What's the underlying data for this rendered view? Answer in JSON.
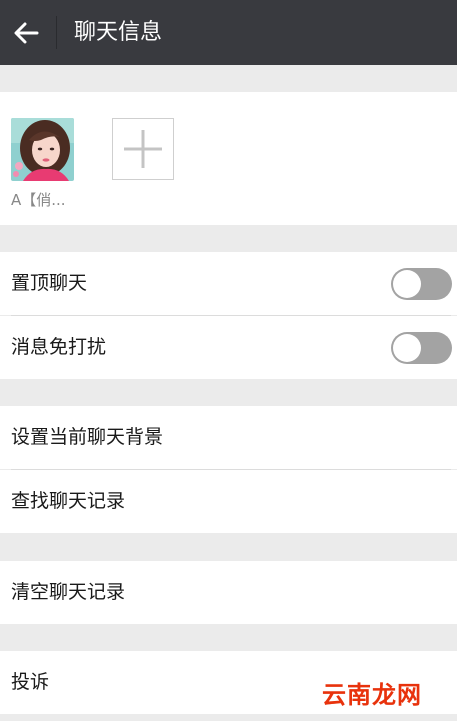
{
  "header": {
    "title": "聊天信息",
    "back_icon": "arrow-left-icon"
  },
  "members": [
    {
      "name": "A【俏...",
      "avatar": "user-avatar"
    }
  ],
  "add_member_icon": "plus-icon",
  "settings": {
    "pin_chat": {
      "label": "置顶聊天",
      "enabled": false
    },
    "mute_notifications": {
      "label": "消息免打扰",
      "enabled": false
    },
    "set_background": {
      "label": "设置当前聊天背景"
    },
    "search_history": {
      "label": "查找聊天记录"
    },
    "clear_history": {
      "label": "清空聊天记录"
    },
    "report": {
      "label": "投诉"
    }
  },
  "watermark": {
    "text": "云南龙网"
  },
  "colors": {
    "topbar": "#393a3f",
    "background": "#ebebeb",
    "toggle_off": "#a3a3a3",
    "watermark": "#e8320c"
  }
}
